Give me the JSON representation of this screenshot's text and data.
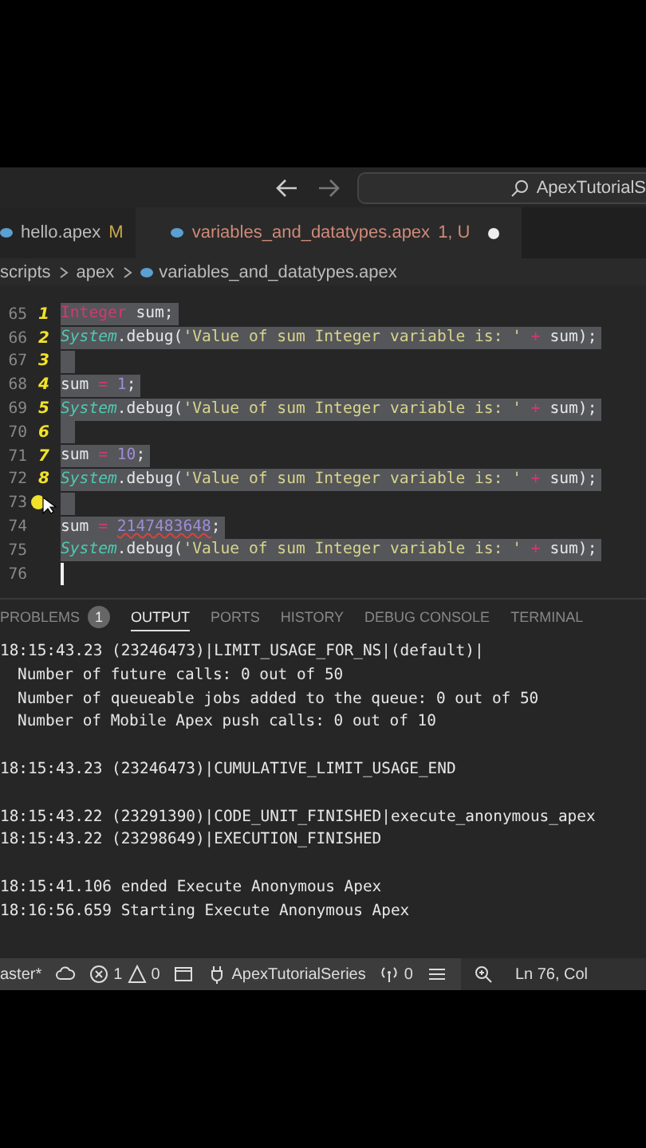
{
  "title_bar": {
    "search_text": "ApexTutorialS"
  },
  "tabs": [
    {
      "label": "hello.apex",
      "badge": "M",
      "selected": false,
      "dirty": false
    },
    {
      "label": "variables_and_datatypes.apex",
      "badge": "1, U",
      "selected": true,
      "dirty": true
    }
  ],
  "breadcrumbs": [
    "scripts",
    "apex",
    "variables_and_datatypes.apex"
  ],
  "editor": {
    "lines": [
      {
        "number": "65",
        "mark": "1",
        "selected": true,
        "tokens": [
          {
            "text": "Integer",
            "kind": "keyword"
          },
          {
            "text": " sum;",
            "kind": "plain"
          }
        ]
      },
      {
        "number": "66",
        "mark": "2",
        "selected": true,
        "tokens": [
          {
            "text": "System",
            "kind": "class"
          },
          {
            "text": ".debug(",
            "kind": "plain"
          },
          {
            "text": "'Value of sum Integer variable is: '",
            "kind": "string"
          },
          {
            "text": " + ",
            "kind": "operator"
          },
          {
            "text": "sum);",
            "kind": "plain"
          }
        ]
      },
      {
        "number": "67",
        "mark": "3",
        "selected": true
      },
      {
        "number": "68",
        "mark": "4",
        "selected": true,
        "tokens": [
          {
            "text": "sum",
            "kind": "plain"
          },
          {
            "text": " = ",
            "kind": "operator"
          },
          {
            "text": "1",
            "kind": "number"
          },
          {
            "text": ";",
            "kind": "plain"
          }
        ]
      },
      {
        "number": "69",
        "mark": "5",
        "selected": true,
        "tokens": [
          {
            "text": "System",
            "kind": "class"
          },
          {
            "text": ".debug(",
            "kind": "plain"
          },
          {
            "text": "'Value of sum Integer variable is: '",
            "kind": "string"
          },
          {
            "text": " + ",
            "kind": "operator"
          },
          {
            "text": "sum);",
            "kind": "plain"
          }
        ]
      },
      {
        "number": "70",
        "mark": "6",
        "selected": true
      },
      {
        "number": "71",
        "mark": "7",
        "selected": true,
        "tokens": [
          {
            "text": "sum",
            "kind": "plain"
          },
          {
            "text": " = ",
            "kind": "operator"
          },
          {
            "text": "10",
            "kind": "number"
          },
          {
            "text": ";",
            "kind": "plain"
          }
        ]
      },
      {
        "number": "72",
        "mark": "8",
        "selected": true,
        "tokens": [
          {
            "text": "System",
            "kind": "class"
          },
          {
            "text": ".debug(",
            "kind": "plain"
          },
          {
            "text": "'Value of sum Integer variable is: '",
            "kind": "string"
          },
          {
            "text": " + ",
            "kind": "operator"
          },
          {
            "text": "sum);",
            "kind": "plain"
          }
        ]
      },
      {
        "number": "73",
        "selected": true,
        "pointer": true
      },
      {
        "number": "74",
        "selected": true,
        "tokens": [
          {
            "text": "sum",
            "kind": "plain"
          },
          {
            "text": " = ",
            "kind": "operator"
          },
          {
            "text": "2147483648",
            "kind": "error_number"
          },
          {
            "text": ";",
            "kind": "plain"
          }
        ]
      },
      {
        "number": "75",
        "selected": true,
        "tokens": [
          {
            "text": "System",
            "kind": "class"
          },
          {
            "text": ".debug(",
            "kind": "plain"
          },
          {
            "text": "'Value of sum Integer variable is: '",
            "kind": "string"
          },
          {
            "text": " + ",
            "kind": "operator"
          },
          {
            "text": "sum);",
            "kind": "plain"
          }
        ]
      },
      {
        "number": "76",
        "selected": false,
        "cursor": true
      }
    ]
  },
  "panel": {
    "tabs": [
      {
        "label": "PROBLEMS",
        "badge": "1",
        "selected": false
      },
      {
        "label": "OUTPUT",
        "selected": true
      },
      {
        "label": "PORTS",
        "selected": false
      },
      {
        "label": "HISTORY",
        "selected": false
      },
      {
        "label": "DEBUG CONSOLE",
        "selected": false
      },
      {
        "label": "TERMINAL",
        "selected": false
      }
    ],
    "output": [
      {
        "text": "18:15:43.23 (23246473)|LIMIT_USAGE_FOR_NS|(default)|",
        "indent": false,
        "gap_before": false
      },
      {
        "text": "Number of future calls: 0 out of 50",
        "indent": true,
        "gap_before": false
      },
      {
        "text": "Number of queueable jobs added to the queue: 0 out of 50",
        "indent": true,
        "gap_before": false
      },
      {
        "text": "Number of Mobile Apex push calls: 0 out of 10",
        "indent": true,
        "gap_before": false
      },
      {
        "text": "18:15:43.23 (23246473)|CUMULATIVE_LIMIT_USAGE_END",
        "indent": false,
        "gap_before": true
      },
      {
        "text": "18:15:43.22 (23291390)|CODE_UNIT_FINISHED|execute_anonymous_apex",
        "indent": false,
        "gap_before": true
      },
      {
        "text": "18:15:43.22 (23298649)|EXECUTION_FINISHED",
        "indent": false,
        "gap_before": false
      },
      {
        "text": "18:15:41.106 ended Execute Anonymous Apex",
        "indent": false,
        "gap_before": true
      },
      {
        "text": "18:16:56.659 Starting Execute Anonymous Apex",
        "indent": false,
        "gap_before": false
      }
    ]
  },
  "status_bar": {
    "branch": "aster*",
    "errors": "1",
    "warnings": "0",
    "org": "ApexTutorialSeries",
    "ports": "0",
    "position": "Ln 76, Col"
  }
}
